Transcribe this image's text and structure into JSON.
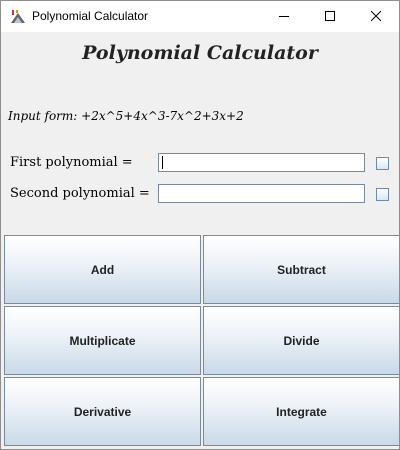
{
  "window": {
    "title": "Polynomial Calculator",
    "controls": {
      "minimize": "minimize",
      "maximize": "maximize",
      "close": "close"
    }
  },
  "main": {
    "heading": "Polynomial Calculator",
    "input_form": "Input form: +2x^5+4x^3-7x^2+3x+2",
    "first_label": "First polynomial =",
    "first_value": "",
    "second_label": "Second polynomial =",
    "second_value": ""
  },
  "buttons": {
    "add": "Add",
    "subtract": "Subtract",
    "multiplicate": "Multiplicate",
    "divide": "Divide",
    "derivative": "Derivative",
    "integrate": "Integrate"
  },
  "icons": {
    "app": "java-app-icon",
    "minimize": "minimize-icon",
    "maximize": "maximize-icon",
    "close": "close-icon"
  },
  "colors": {
    "button_border": "#7a8a99",
    "button_gradient_bottom": "#c9d9e8",
    "window_background": "#f0f0f0"
  }
}
